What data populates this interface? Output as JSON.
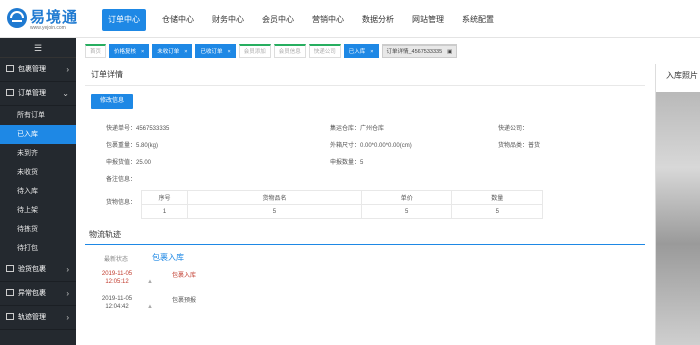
{
  "logo": {
    "name": "易境通",
    "url": "www.yejoin.com"
  },
  "topnav": [
    "订单中心",
    "仓储中心",
    "财务中心",
    "会员中心",
    "营销中心",
    "数据分析",
    "网站管理",
    "系统配置"
  ],
  "sidebar": {
    "toggle": "☰",
    "groups": [
      {
        "label": "包裹管理"
      },
      {
        "label": "订单管理"
      },
      {
        "label": "验货包裹"
      },
      {
        "label": "异常包裹"
      },
      {
        "label": "轨迹管理"
      }
    ],
    "order_subitems": [
      "所有订单",
      "已入库",
      "未到齐",
      "未收货",
      "待入库",
      "待上架",
      "待拣货",
      "待打包"
    ]
  },
  "tabs": [
    "首页",
    "价格复核",
    "未收订单",
    "已收订单",
    "会员添加",
    "会员信息",
    "快递公司",
    "已入库",
    "订单详情_4567533335"
  ],
  "panel": {
    "title": "订单详情",
    "edit_button": "修改信息",
    "fields": {
      "tracking": "快递单号：4567533335",
      "warehouse": "集运仓库：广州仓库",
      "courier": "快递公司：",
      "weight": "包裹重量：5.80(kg)",
      "size": "外箱尺寸：0.00*0.00*0.00(cm)",
      "goods_type": "货物品类：普货",
      "declared_value": "申报货值：25.00",
      "declared_qty": "申报数量：5",
      "remark": "备注信息："
    },
    "goods": {
      "label": "货物信息：",
      "headers": [
        "序号",
        "货物品名",
        "单价",
        "数量"
      ],
      "rows": [
        [
          "1",
          "5",
          "5",
          "5"
        ]
      ]
    }
  },
  "logistics": {
    "title": "物流轨迹",
    "latest_label": "最新状态",
    "latest_value": "包裹入库",
    "events": [
      {
        "date": "2019-11-05",
        "time": "12:05:12",
        "status": "包裹入库"
      },
      {
        "date": "2019-11-05",
        "time": "12:04:42",
        "status": "包裹预报"
      }
    ]
  },
  "right": {
    "title": "入库照片"
  },
  "colors": {
    "accent": "#1e88e5",
    "sidebar_bg": "#24292f",
    "tab_green": "#27ae60",
    "red": "#c0392b"
  }
}
